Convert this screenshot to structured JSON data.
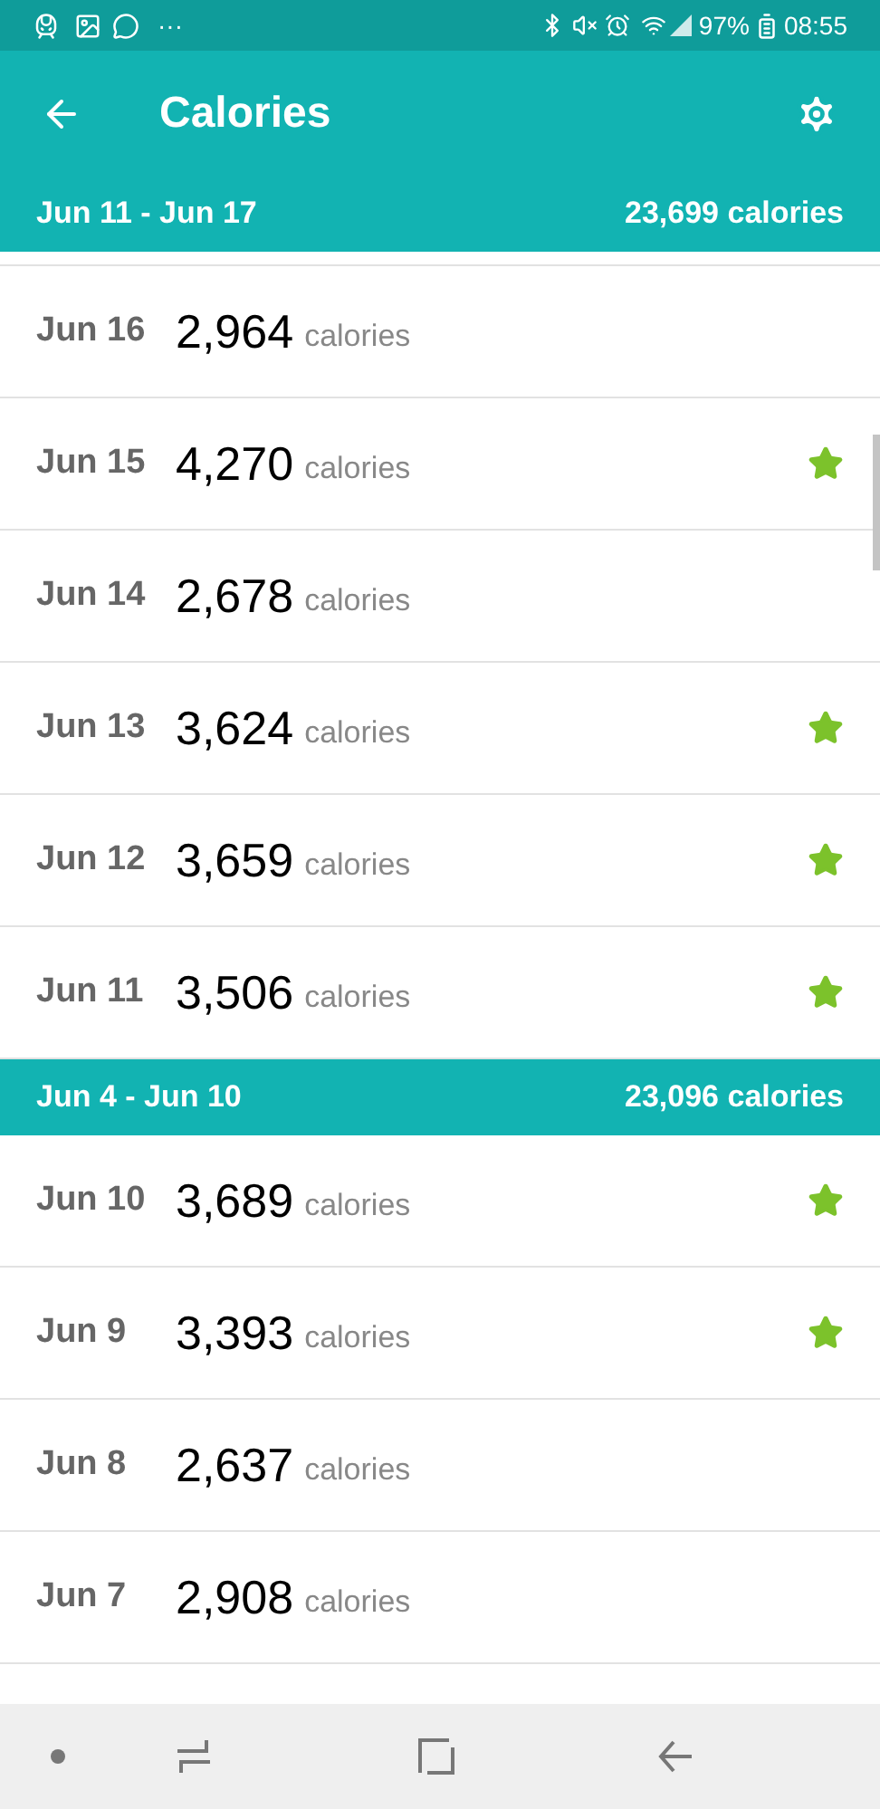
{
  "status_bar": {
    "more": "···",
    "battery": "97%",
    "time": "08:55"
  },
  "app_bar": {
    "title": "Calories"
  },
  "weeks": [
    {
      "range": "Jun 11 - Jun 17",
      "total": "23,699 calories",
      "days": [
        {
          "date": "Jun 16",
          "value": "2,964",
          "unit": "calories",
          "starred": false
        },
        {
          "date": "Jun 15",
          "value": "4,270",
          "unit": "calories",
          "starred": true
        },
        {
          "date": "Jun 14",
          "value": "2,678",
          "unit": "calories",
          "starred": false
        },
        {
          "date": "Jun 13",
          "value": "3,624",
          "unit": "calories",
          "starred": true
        },
        {
          "date": "Jun 12",
          "value": "3,659",
          "unit": "calories",
          "starred": true
        },
        {
          "date": "Jun 11",
          "value": "3,506",
          "unit": "calories",
          "starred": true
        }
      ]
    },
    {
      "range": "Jun 4 - Jun 10",
      "total": "23,096 calories",
      "days": [
        {
          "date": "Jun 10",
          "value": "3,689",
          "unit": "calories",
          "starred": true
        },
        {
          "date": "Jun 9",
          "value": "3,393",
          "unit": "calories",
          "starred": true
        },
        {
          "date": "Jun 8",
          "value": "2,637",
          "unit": "calories",
          "starred": false
        },
        {
          "date": "Jun 7",
          "value": "2,908",
          "unit": "calories",
          "starred": false
        }
      ]
    }
  ]
}
